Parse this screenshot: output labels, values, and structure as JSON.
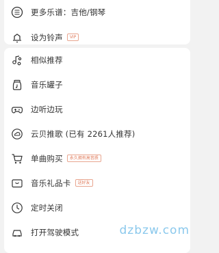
{
  "top_menu": [
    {
      "label": "更多乐谱：吉他/钢琴",
      "icon": "music-score-icon"
    },
    {
      "label": "设为铃声",
      "icon": "ringtone-icon",
      "tag": "VIP"
    }
  ],
  "menu": [
    {
      "label": "相似推荐",
      "icon": "similar-music-icon"
    },
    {
      "label": "音乐罐子",
      "icon": "music-jar-icon"
    },
    {
      "label": "边听边玩",
      "icon": "gamepad-icon"
    },
    {
      "label": "云贝推歌 (已有 2261人推荐)",
      "icon": "cloud-coin-icon"
    },
    {
      "label": "单曲购买",
      "icon": "cart-icon",
      "tag": "永久拥有高音质"
    },
    {
      "label": "音乐礼品卡",
      "icon": "gift-card-icon",
      "tag": "送好友"
    },
    {
      "label": "定时关闭",
      "icon": "clock-icon"
    },
    {
      "label": "打开驾驶模式",
      "icon": "car-icon"
    }
  ],
  "watermark": "dzbzw.com",
  "colors": {
    "tag": "#e07a5a",
    "text": "#333333",
    "watermark": "#7ec3ea"
  }
}
